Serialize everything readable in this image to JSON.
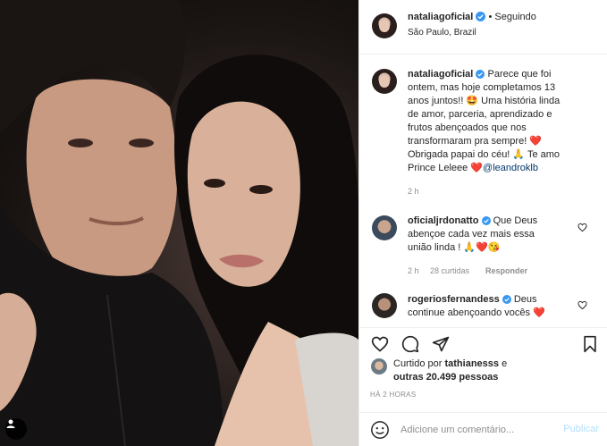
{
  "post": {
    "account": "nataliagoficial",
    "follow_state": "Seguindo",
    "separator": "•",
    "location": "São Paulo, Brazil"
  },
  "caption": {
    "username": "nataliagoficial",
    "lines": [
      "Parece que foi",
      "ontem, mas hoje completamos 13",
      "anos juntos!! 🤩 Uma história linda",
      "de amor, parceria, aprendizado e",
      "frutos abençoados que nos",
      "transformaram pra sempre! ❤️",
      "Obrigada papai do céu! 🙏 Te amo",
      "Prince Leleee ❤️"
    ],
    "mention": "@leandroklb",
    "time": "2 h"
  },
  "comments": [
    {
      "username": "oficialjrdonatto",
      "lines": [
        "Que Deus",
        "abençoe cada vez mais essa",
        "união linda ! 🙏❤️😘"
      ],
      "time": "2 h",
      "likes": "28 curtidas",
      "reply": "Responder"
    },
    {
      "username": "rogeriosfernandess",
      "lines": [
        "Deus",
        "continue abençoando vocês ❤️"
      ]
    }
  ],
  "likes": {
    "prefix": "Curtido por",
    "user": "tathianesss",
    "connector": "e",
    "others": "outras 20.499 pessoas"
  },
  "time_ago": "HÁ 2 HORAS",
  "add_comment": {
    "placeholder": "Adicione um comentário...",
    "publish": "Publicar"
  },
  "colors": {
    "verified": "#3897f0",
    "heart": "#ed4956",
    "link": "#00376b",
    "publish_disabled": "#b2dffc"
  }
}
